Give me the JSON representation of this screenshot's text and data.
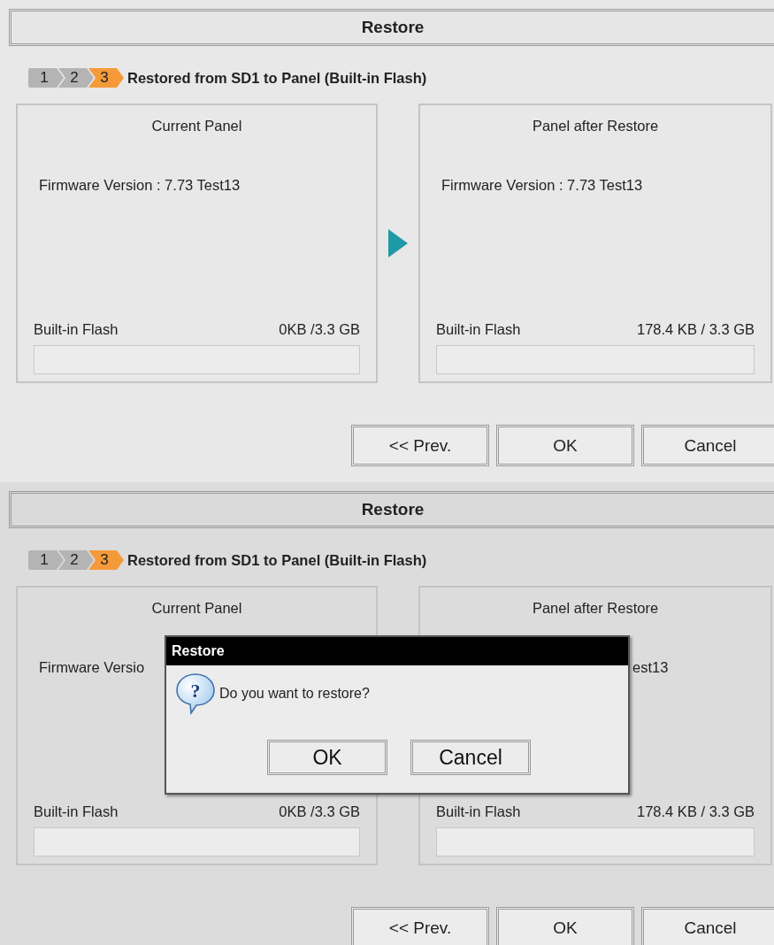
{
  "screens": [
    {
      "title": "Restore",
      "steps": [
        {
          "label": "1",
          "selected": false
        },
        {
          "label": "2",
          "selected": false
        },
        {
          "label": "3",
          "selected": true
        }
      ],
      "step_caption": "Restored from SD1 to Panel (Built-in Flash)",
      "panels": [
        {
          "heading": "Current Panel",
          "firmware": "Firmware Version : 7.73 Test13",
          "storage_label": "Built-in Flash",
          "storage_value": "0KB /3.3 GB"
        },
        {
          "heading": "Panel after Restore",
          "firmware": "Firmware Version : 7.73 Test13",
          "storage_label": "Built-in Flash",
          "storage_value": "178.4 KB / 3.3 GB"
        }
      ],
      "buttons": [
        "<< Prev.",
        "OK",
        "Cancel"
      ]
    },
    {
      "title": "Restore",
      "steps": [
        {
          "label": "1",
          "selected": false
        },
        {
          "label": "2",
          "selected": false
        },
        {
          "label": "3",
          "selected": true
        }
      ],
      "step_caption": "Restored from SD1 to Panel (Built-in Flash)",
      "panels": [
        {
          "heading": "Current Panel",
          "firmware": "Firmware Versio",
          "storage_label": "Built-in Flash",
          "storage_value": "0KB /3.3 GB"
        },
        {
          "heading": "Panel after Restore",
          "firmware": "est13",
          "storage_label": "Built-in Flash",
          "storage_value": "178.4 KB / 3.3 GB"
        }
      ],
      "buttons": [
        "<< Prev.",
        "OK",
        "Cancel"
      ],
      "dialog": {
        "title": "Restore",
        "icon": "?",
        "message": "Do you want to restore?",
        "buttons": [
          "OK",
          "Cancel"
        ]
      }
    }
  ]
}
